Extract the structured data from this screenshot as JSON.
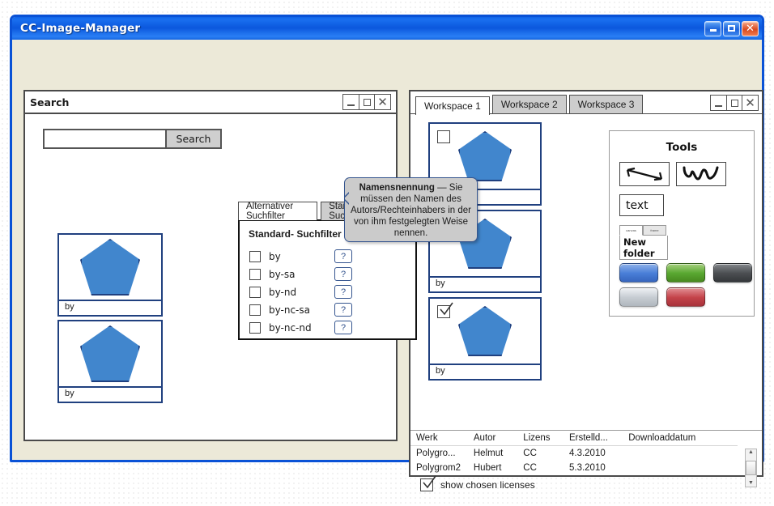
{
  "window": {
    "title": "CC-Image-Manager",
    "controls": {
      "minimize": "minimize-button",
      "maximize": "maximize-button",
      "close": "close-button"
    }
  },
  "search_panel": {
    "title": "Search",
    "search_input_value": "",
    "search_input_placeholder": "",
    "search_button_label": "Search",
    "thumbnails": [
      {
        "license": "by"
      },
      {
        "license": "by"
      }
    ],
    "filter_tabs": [
      {
        "label": "Alternativer Suchfilter",
        "active": true
      },
      {
        "label": "Standard- Suchfilter",
        "active": false
      }
    ],
    "filter_box": {
      "heading": "Standard- Suchfilter",
      "help_button_label": "?",
      "items": [
        {
          "label": "by",
          "checked": false
        },
        {
          "label": "by-sa",
          "checked": false
        },
        {
          "label": "by-nd",
          "checked": false
        },
        {
          "label": "by-nc-sa",
          "checked": false
        },
        {
          "label": "by-nc-nd",
          "checked": false
        }
      ]
    },
    "tooltip": {
      "term": "Namensnennung",
      "dash": " — ",
      "body": "Sie müssen den Namen des Autors/Rechteinhabers in der von ihm festgelegten Weise nennen."
    }
  },
  "workspace_panel": {
    "tabs": [
      {
        "label": "Workspace 1",
        "active": true
      },
      {
        "label": "Workspace 2",
        "active": false
      },
      {
        "label": "Workspace 3",
        "active": false
      }
    ],
    "thumbnails": [
      {
        "license": "",
        "selected": false
      },
      {
        "license": "by",
        "selected": true
      },
      {
        "license": "by",
        "selected": true
      }
    ],
    "show_licenses": {
      "label": "show chosen licenses",
      "checked": true
    },
    "tools": {
      "title": "Tools",
      "arrow_tool": "arrow-tool",
      "squiggle_tool": "squiggle-tool",
      "text_tool_label": "text",
      "folder": {
        "tabs": [
          {
            "label": "canvas"
          },
          {
            "label": "frame"
          }
        ],
        "body_label": "New folder"
      },
      "color_buttons": [
        {
          "name": "blue",
          "color": "#4a7fd8"
        },
        {
          "name": "green",
          "color": "#5aa832"
        },
        {
          "name": "dark-gray",
          "color": "#4c4f52"
        },
        {
          "name": "light-gray",
          "color": "#c6ccd2"
        },
        {
          "name": "red",
          "color": "#c4434a"
        }
      ]
    },
    "table": {
      "columns": [
        "Werk",
        "Autor",
        "Lizens",
        "Erstelld...",
        "Downloaddatum"
      ],
      "rows": [
        [
          "Polygro...",
          "Helmut",
          "CC",
          "4.3.2010",
          ""
        ],
        [
          "Polygrom2",
          "Hubert",
          "CC",
          "5.3.2010",
          ""
        ]
      ]
    }
  }
}
